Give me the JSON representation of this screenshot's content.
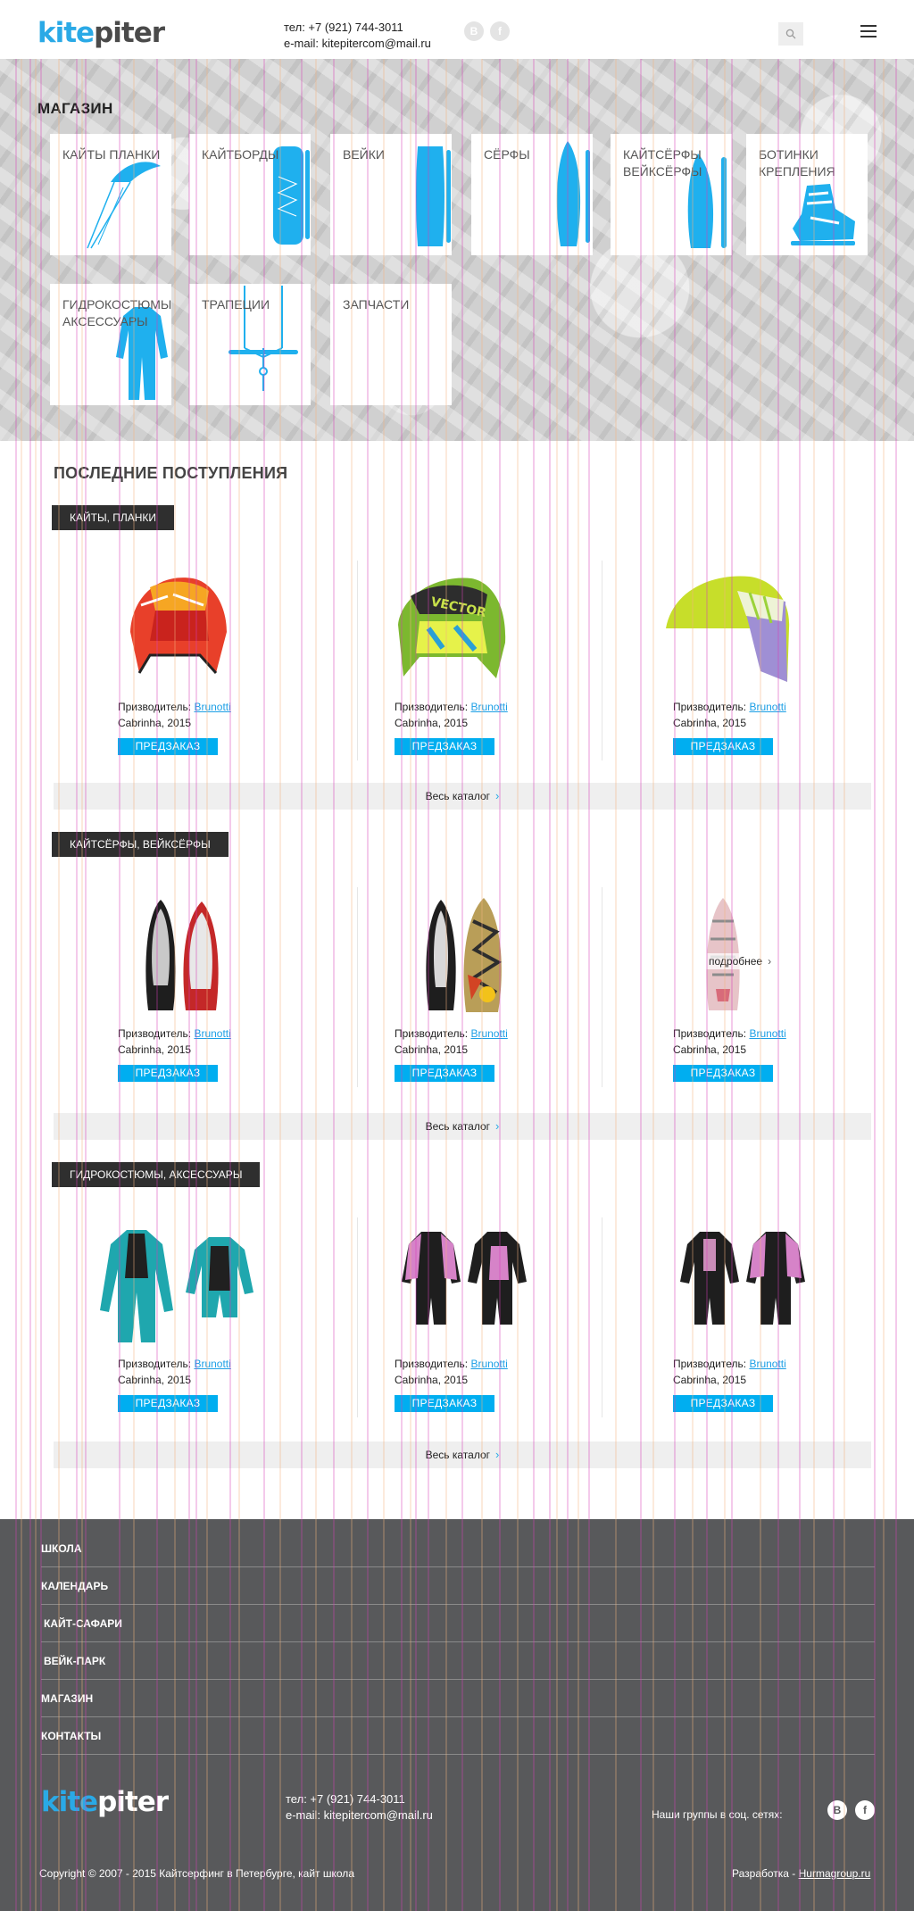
{
  "header": {
    "logo_part1": "kite",
    "logo_part2": "piter",
    "phone": "тел: +7 (921) 744-3011",
    "email": "e-mail: kitepitercom@mail.ru",
    "social": [
      "В",
      "f"
    ]
  },
  "shop": {
    "title": "МАГАЗИН",
    "categories": [
      {
        "label": "КАЙТЫ ПЛАНКИ",
        "icon": "kite-icon"
      },
      {
        "label": "КАЙТБОРДЫ",
        "icon": "kiteboard-icon"
      },
      {
        "label": "ВЕЙКИ",
        "icon": "wakeboard-icon"
      },
      {
        "label": "СЁРФЫ",
        "icon": "surfboard-icon"
      },
      {
        "label": "КАЙТСЁРФЫ ВЕЙКСЁРФЫ",
        "icon": "kitesurf-icon"
      },
      {
        "label": "БОТИНКИ КРЕПЛЕНИЯ",
        "icon": "boot-binding-icon"
      },
      {
        "label": "ГИДРОКОСТЮМЫ АКСЕССУАРЫ",
        "icon": "wetsuit-icon"
      },
      {
        "label": "ТРАПЕЦИИ",
        "icon": "trapeze-bar-icon"
      },
      {
        "label": "ЗАПЧАСТИ",
        "icon": ""
      }
    ]
  },
  "latest": {
    "title": "ПОСЛЕДНИЕ ПОСТУПЛЕНИЯ",
    "maker_prefix": "Призводитель:",
    "order_label": "ПРЕДЗАКАЗ",
    "catalog_link": "Весь каталог",
    "more_label": "подробнее",
    "groups": [
      {
        "label": "КАЙТЫ, ПЛАНКИ",
        "items": [
          {
            "maker": "Brunotti",
            "model": "Cabrinha, 2015",
            "image": "kite-red-orange"
          },
          {
            "maker": "Brunotti",
            "model": "Cabrinha, 2015",
            "image": "kite-vector-green"
          },
          {
            "maker": "Brunotti",
            "model": "Cabrinha, 2015",
            "image": "kite-lime-purple"
          }
        ]
      },
      {
        "label": "КАЙТСЁРФЫ, ВЕЙКСЁРФЫ",
        "items": [
          {
            "maker": "Brunotti",
            "model": "Cabrinha, 2015",
            "image": "wakesurf-red-white"
          },
          {
            "maker": "Brunotti",
            "model": "Cabrinha, 2015",
            "image": "wakesurf-black-pattern"
          },
          {
            "maker": "Brunotti",
            "model": "Cabrinha, 2015",
            "image": "wakesurf-pink-grey"
          }
        ]
      },
      {
        "label": "ГИДРОКОСТЮМЫ, АКСЕССУАРЫ",
        "items": [
          {
            "maker": "Brunotti",
            "model": "Cabrinha, 2015",
            "image": "wetsuit-teal"
          },
          {
            "maker": "Brunotti",
            "model": "Cabrinha, 2015",
            "image": "wetsuit-black-pink"
          },
          {
            "maker": "Brunotti",
            "model": "Cabrinha, 2015",
            "image": "wetsuit-black-pink-2"
          }
        ]
      }
    ]
  },
  "footer": {
    "nav": [
      "ШКОЛА",
      "КАЛЕНДАРЬ",
      "КАЙТ-САФАРИ",
      "ВЕЙК-ПАРК",
      "МАГАЗИН",
      "КОНТАКТЫ"
    ],
    "logo_part1": "kite",
    "logo_part2": "piter",
    "phone": "тел: +7 (921) 744-3011",
    "email": "e-mail: kitepitercom@mail.ru",
    "social_label": "Наши группы в соц. сетях:",
    "social": [
      "В",
      "f"
    ],
    "copyright": "Copyright © 2007 - 2015 Кайтсерфинг в Петербурге, кайт школа",
    "dev_label": "Разработка -",
    "dev_link": "Hurmagroup.ru"
  },
  "colors": {
    "accent": "#00aef0",
    "logo_blue": "#2aa9e6",
    "footer_bg": "#58595b",
    "label_bg": "#2f2f2f",
    "guide_magenta": "#d63fb8",
    "guide_orange": "#f3b27f"
  }
}
